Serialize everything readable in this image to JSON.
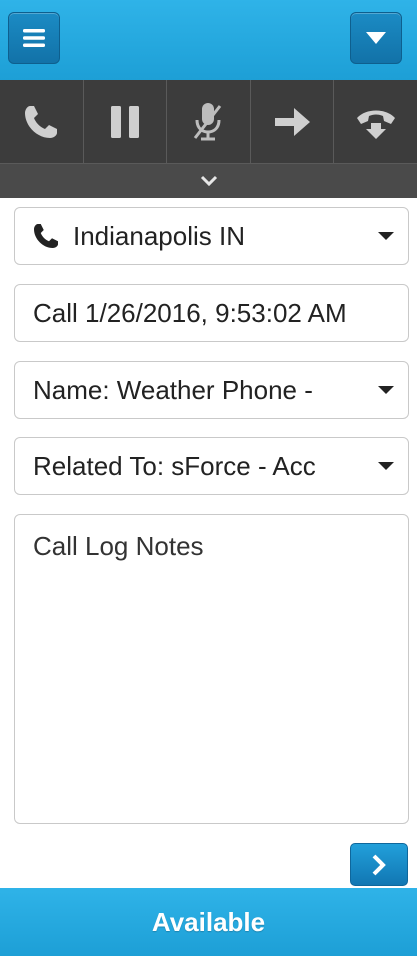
{
  "header": {
    "menu_icon": "hamburger-menu-icon",
    "dropdown_icon": "caret-down-icon"
  },
  "controls": [
    {
      "name": "call",
      "icon": "phone-icon"
    },
    {
      "name": "hold",
      "icon": "pause-icon"
    },
    {
      "name": "mute",
      "icon": "microphone-mute-icon"
    },
    {
      "name": "transfer",
      "icon": "arrow-right-icon"
    },
    {
      "name": "hangup",
      "icon": "phone-hangup-icon"
    }
  ],
  "expander_icon": "chevron-down-icon",
  "location": {
    "label": "Indianapolis IN",
    "icon": "phone-icon"
  },
  "call_subject": {
    "value": "Call 1/26/2016, 9:53:02 AM"
  },
  "name_select": {
    "label": "Name: Weather Phone - "
  },
  "related_select": {
    "label": "Related To: sForce - Acc"
  },
  "notes": {
    "placeholder": "Call Log Notes",
    "value": ""
  },
  "next_icon": "chevron-right-icon",
  "status": {
    "label": "Available"
  },
  "colors": {
    "accent": "#1d9fd6",
    "button_dark": "#1272a8",
    "toolbar": "#3c3c3c",
    "icon_gray": "#d0d0d0"
  }
}
